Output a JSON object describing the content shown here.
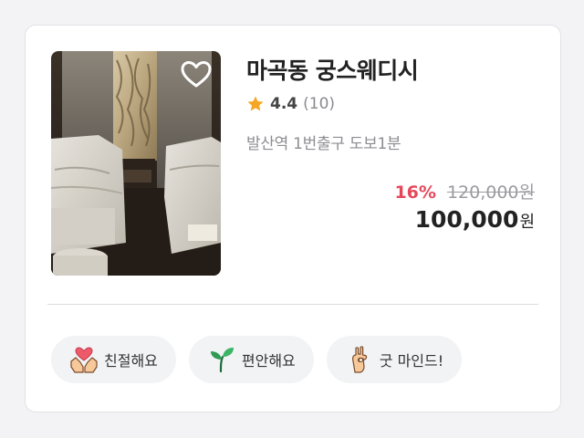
{
  "product": {
    "title": "마곡동 궁스웨디시",
    "rating": "4.4",
    "review_count": "(10)",
    "location": "발산역 1번출구 도보1분",
    "discount": "16%",
    "original_price": "120,000원",
    "price_amount": "100,000",
    "price_unit": "원",
    "favorited": false
  },
  "tags": [
    {
      "label": "친절해요",
      "icon": "hands-heart-icon"
    },
    {
      "label": "편안해요",
      "icon": "sprout-icon"
    },
    {
      "label": "굿 마인드!",
      "icon": "ok-hand-icon"
    }
  ],
  "colors": {
    "discount": "#e5485a",
    "star": "#f5a623",
    "tag_background": "#f2f3f5"
  }
}
